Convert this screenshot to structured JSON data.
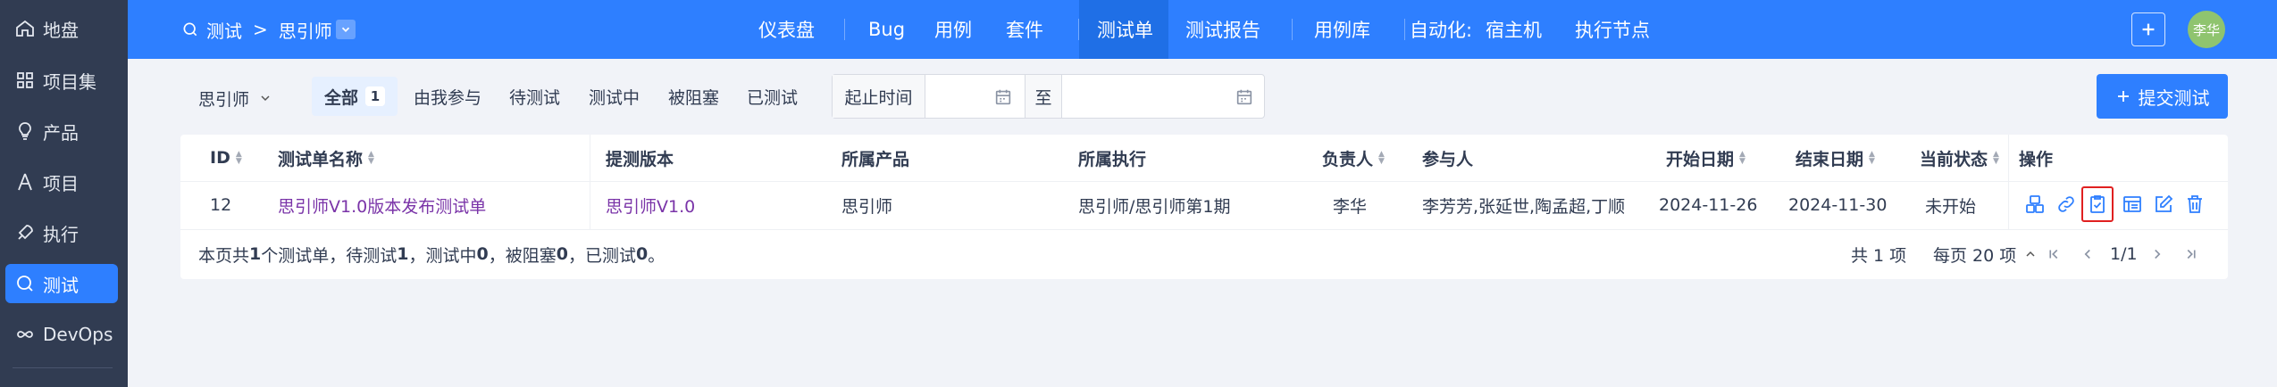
{
  "sidebar": {
    "items": [
      {
        "label": "地盘",
        "icon": "home-icon"
      },
      {
        "label": "项目集",
        "icon": "grid-icon"
      },
      {
        "label": "产品",
        "icon": "lightbulb-icon"
      },
      {
        "label": "项目",
        "icon": "project-icon"
      },
      {
        "label": "执行",
        "icon": "rocket-icon"
      },
      {
        "label": "测试",
        "icon": "test-icon"
      },
      {
        "label": "DevOps",
        "icon": "infinity-icon"
      }
    ],
    "active": "测试"
  },
  "topbar": {
    "breadcrumb_root": "测试",
    "breadcrumb_sep": ">",
    "breadcrumb_product": "思引师",
    "nav": [
      "仪表盘",
      "Bug",
      "用例",
      "套件",
      "测试单",
      "测试报告",
      "用例库",
      "自动化:",
      "宿主机",
      "执行节点"
    ],
    "active_nav": "测试单",
    "avatar_text": "李华"
  },
  "filters": {
    "product": "思引师",
    "tabs": [
      {
        "label": "全部",
        "count": "1"
      },
      {
        "label": "由我参与"
      },
      {
        "label": "待测试"
      },
      {
        "label": "测试中"
      },
      {
        "label": "被阻塞"
      },
      {
        "label": "已测试"
      }
    ],
    "date_start_label": "起止时间",
    "date_to_label": "至",
    "submit_label": "提交测试"
  },
  "table": {
    "headers": [
      "ID",
      "测试单名称",
      "提测版本",
      "所属产品",
      "所属执行",
      "负责人",
      "参与人",
      "开始日期",
      "结束日期",
      "当前状态",
      "操作"
    ],
    "rows": [
      {
        "id": "12",
        "name": "思引师V1.0版本发布测试单",
        "build": "思引师V1.0",
        "product": "思引师",
        "execution": "思引师/思引师第1期",
        "owner": "李华",
        "members": "李芳芳,张延世,陶孟超,丁顺",
        "begin": "2024-11-26",
        "end": "2024-11-30",
        "status": "未开始"
      }
    ],
    "action_icons": [
      "group-case-icon",
      "link-icon",
      "clipboard-check-icon",
      "report-icon",
      "edit-icon",
      "delete-icon"
    ],
    "summary_prefix": "本页共 ",
    "summary_total": "1",
    "summary_mid1": " 个测试单，待测试 ",
    "summary_wait": "1",
    "summary_mid2": "，测试中 ",
    "summary_doing": "0",
    "summary_mid3": "，被阻塞 ",
    "summary_blocked": "0",
    "summary_mid4": "，已测试 ",
    "summary_done": "0",
    "summary_end": "。",
    "pager_total": "共 1 项",
    "pager_per_page": "每页 20 项",
    "pager_pages": "1/1"
  },
  "colors": {
    "primary": "#2e7fff",
    "sidebar": "#313c52",
    "link": "#7a34a8",
    "highlight": "#e02020"
  }
}
